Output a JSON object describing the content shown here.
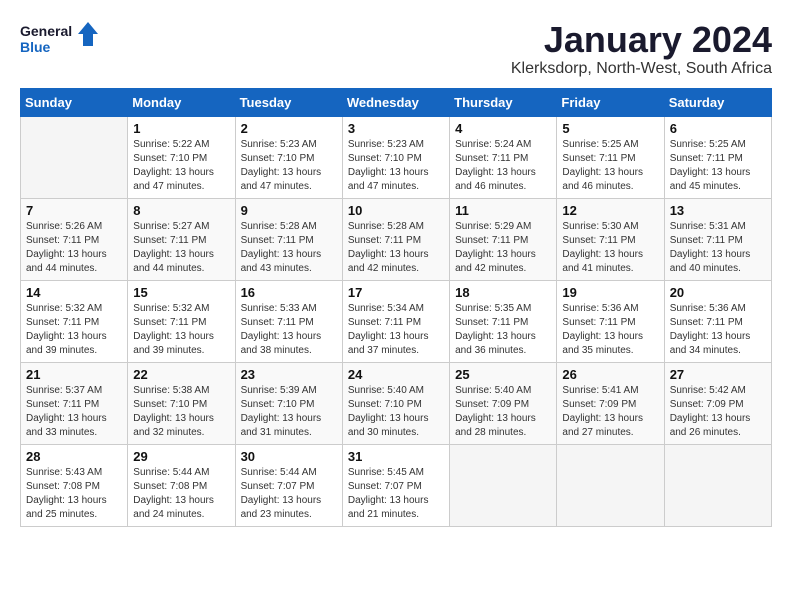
{
  "logo": {
    "text_general": "General",
    "text_blue": "Blue"
  },
  "title": "January 2024",
  "subtitle": "Klerksdorp, North-West, South Africa",
  "weekdays": [
    "Sunday",
    "Monday",
    "Tuesday",
    "Wednesday",
    "Thursday",
    "Friday",
    "Saturday"
  ],
  "weeks": [
    [
      {
        "day": "",
        "sunrise": "",
        "sunset": "",
        "daylight": "",
        "empty": true
      },
      {
        "day": "1",
        "sunrise": "5:22 AM",
        "sunset": "7:10 PM",
        "daylight": "13 hours and 47 minutes.",
        "empty": false
      },
      {
        "day": "2",
        "sunrise": "5:23 AM",
        "sunset": "7:10 PM",
        "daylight": "13 hours and 47 minutes.",
        "empty": false
      },
      {
        "day": "3",
        "sunrise": "5:23 AM",
        "sunset": "7:10 PM",
        "daylight": "13 hours and 47 minutes.",
        "empty": false
      },
      {
        "day": "4",
        "sunrise": "5:24 AM",
        "sunset": "7:11 PM",
        "daylight": "13 hours and 46 minutes.",
        "empty": false
      },
      {
        "day": "5",
        "sunrise": "5:25 AM",
        "sunset": "7:11 PM",
        "daylight": "13 hours and 46 minutes.",
        "empty": false
      },
      {
        "day": "6",
        "sunrise": "5:25 AM",
        "sunset": "7:11 PM",
        "daylight": "13 hours and 45 minutes.",
        "empty": false
      }
    ],
    [
      {
        "day": "7",
        "sunrise": "5:26 AM",
        "sunset": "7:11 PM",
        "daylight": "13 hours and 44 minutes.",
        "empty": false
      },
      {
        "day": "8",
        "sunrise": "5:27 AM",
        "sunset": "7:11 PM",
        "daylight": "13 hours and 44 minutes.",
        "empty": false
      },
      {
        "day": "9",
        "sunrise": "5:28 AM",
        "sunset": "7:11 PM",
        "daylight": "13 hours and 43 minutes.",
        "empty": false
      },
      {
        "day": "10",
        "sunrise": "5:28 AM",
        "sunset": "7:11 PM",
        "daylight": "13 hours and 42 minutes.",
        "empty": false
      },
      {
        "day": "11",
        "sunrise": "5:29 AM",
        "sunset": "7:11 PM",
        "daylight": "13 hours and 42 minutes.",
        "empty": false
      },
      {
        "day": "12",
        "sunrise": "5:30 AM",
        "sunset": "7:11 PM",
        "daylight": "13 hours and 41 minutes.",
        "empty": false
      },
      {
        "day": "13",
        "sunrise": "5:31 AM",
        "sunset": "7:11 PM",
        "daylight": "13 hours and 40 minutes.",
        "empty": false
      }
    ],
    [
      {
        "day": "14",
        "sunrise": "5:32 AM",
        "sunset": "7:11 PM",
        "daylight": "13 hours and 39 minutes.",
        "empty": false
      },
      {
        "day": "15",
        "sunrise": "5:32 AM",
        "sunset": "7:11 PM",
        "daylight": "13 hours and 39 minutes.",
        "empty": false
      },
      {
        "day": "16",
        "sunrise": "5:33 AM",
        "sunset": "7:11 PM",
        "daylight": "13 hours and 38 minutes.",
        "empty": false
      },
      {
        "day": "17",
        "sunrise": "5:34 AM",
        "sunset": "7:11 PM",
        "daylight": "13 hours and 37 minutes.",
        "empty": false
      },
      {
        "day": "18",
        "sunrise": "5:35 AM",
        "sunset": "7:11 PM",
        "daylight": "13 hours and 36 minutes.",
        "empty": false
      },
      {
        "day": "19",
        "sunrise": "5:36 AM",
        "sunset": "7:11 PM",
        "daylight": "13 hours and 35 minutes.",
        "empty": false
      },
      {
        "day": "20",
        "sunrise": "5:36 AM",
        "sunset": "7:11 PM",
        "daylight": "13 hours and 34 minutes.",
        "empty": false
      }
    ],
    [
      {
        "day": "21",
        "sunrise": "5:37 AM",
        "sunset": "7:11 PM",
        "daylight": "13 hours and 33 minutes.",
        "empty": false
      },
      {
        "day": "22",
        "sunrise": "5:38 AM",
        "sunset": "7:10 PM",
        "daylight": "13 hours and 32 minutes.",
        "empty": false
      },
      {
        "day": "23",
        "sunrise": "5:39 AM",
        "sunset": "7:10 PM",
        "daylight": "13 hours and 31 minutes.",
        "empty": false
      },
      {
        "day": "24",
        "sunrise": "5:40 AM",
        "sunset": "7:10 PM",
        "daylight": "13 hours and 30 minutes.",
        "empty": false
      },
      {
        "day": "25",
        "sunrise": "5:40 AM",
        "sunset": "7:09 PM",
        "daylight": "13 hours and 28 minutes.",
        "empty": false
      },
      {
        "day": "26",
        "sunrise": "5:41 AM",
        "sunset": "7:09 PM",
        "daylight": "13 hours and 27 minutes.",
        "empty": false
      },
      {
        "day": "27",
        "sunrise": "5:42 AM",
        "sunset": "7:09 PM",
        "daylight": "13 hours and 26 minutes.",
        "empty": false
      }
    ],
    [
      {
        "day": "28",
        "sunrise": "5:43 AM",
        "sunset": "7:08 PM",
        "daylight": "13 hours and 25 minutes.",
        "empty": false
      },
      {
        "day": "29",
        "sunrise": "5:44 AM",
        "sunset": "7:08 PM",
        "daylight": "13 hours and 24 minutes.",
        "empty": false
      },
      {
        "day": "30",
        "sunrise": "5:44 AM",
        "sunset": "7:07 PM",
        "daylight": "13 hours and 23 minutes.",
        "empty": false
      },
      {
        "day": "31",
        "sunrise": "5:45 AM",
        "sunset": "7:07 PM",
        "daylight": "13 hours and 21 minutes.",
        "empty": false
      },
      {
        "day": "",
        "sunrise": "",
        "sunset": "",
        "daylight": "",
        "empty": true
      },
      {
        "day": "",
        "sunrise": "",
        "sunset": "",
        "daylight": "",
        "empty": true
      },
      {
        "day": "",
        "sunrise": "",
        "sunset": "",
        "daylight": "",
        "empty": true
      }
    ]
  ],
  "labels": {
    "sunrise": "Sunrise:",
    "sunset": "Sunset:",
    "daylight": "Daylight:"
  }
}
